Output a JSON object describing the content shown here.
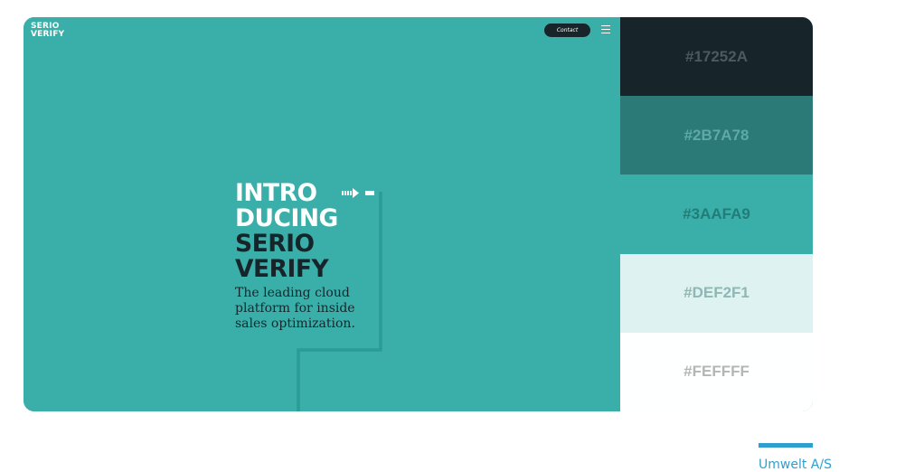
{
  "site": {
    "logo": {
      "line1": "SERIO",
      "line2": "VERIFY"
    },
    "contact_label": "Contact",
    "menu_icon": "hamburger-icon"
  },
  "hero": {
    "headline_white": [
      "INTRO",
      "DUCING"
    ],
    "headline_dark": [
      "SERIO",
      "VERIFY"
    ],
    "subtitle": "The leading cloud platform for inside sales optimization.",
    "arrow_icon": "dashed-arrow-icon"
  },
  "palette": {
    "swatches": [
      {
        "label": "#17252A",
        "bg": "#17252A",
        "fg": "#4A5A60"
      },
      {
        "label": "#2B7A78",
        "bg": "#2B7A78",
        "fg": "#5FA9A6"
      },
      {
        "label": "#3AAFA9",
        "bg": "#3AAFA9",
        "fg": "#207D78"
      },
      {
        "label": "#DEF2F1",
        "bg": "#DEF2F1",
        "fg": "#8FB7B4"
      },
      {
        "label": "#FEFFFF",
        "bg": "#FEFFFF",
        "fg": "#B5B5B5"
      }
    ]
  },
  "caption": {
    "text": "Umwelt A/S",
    "color": "#2E9FD0"
  },
  "colors": {
    "hero_bg": "#3AAFA9",
    "dark": "#17252A",
    "accent_line": "#2B9C95"
  }
}
